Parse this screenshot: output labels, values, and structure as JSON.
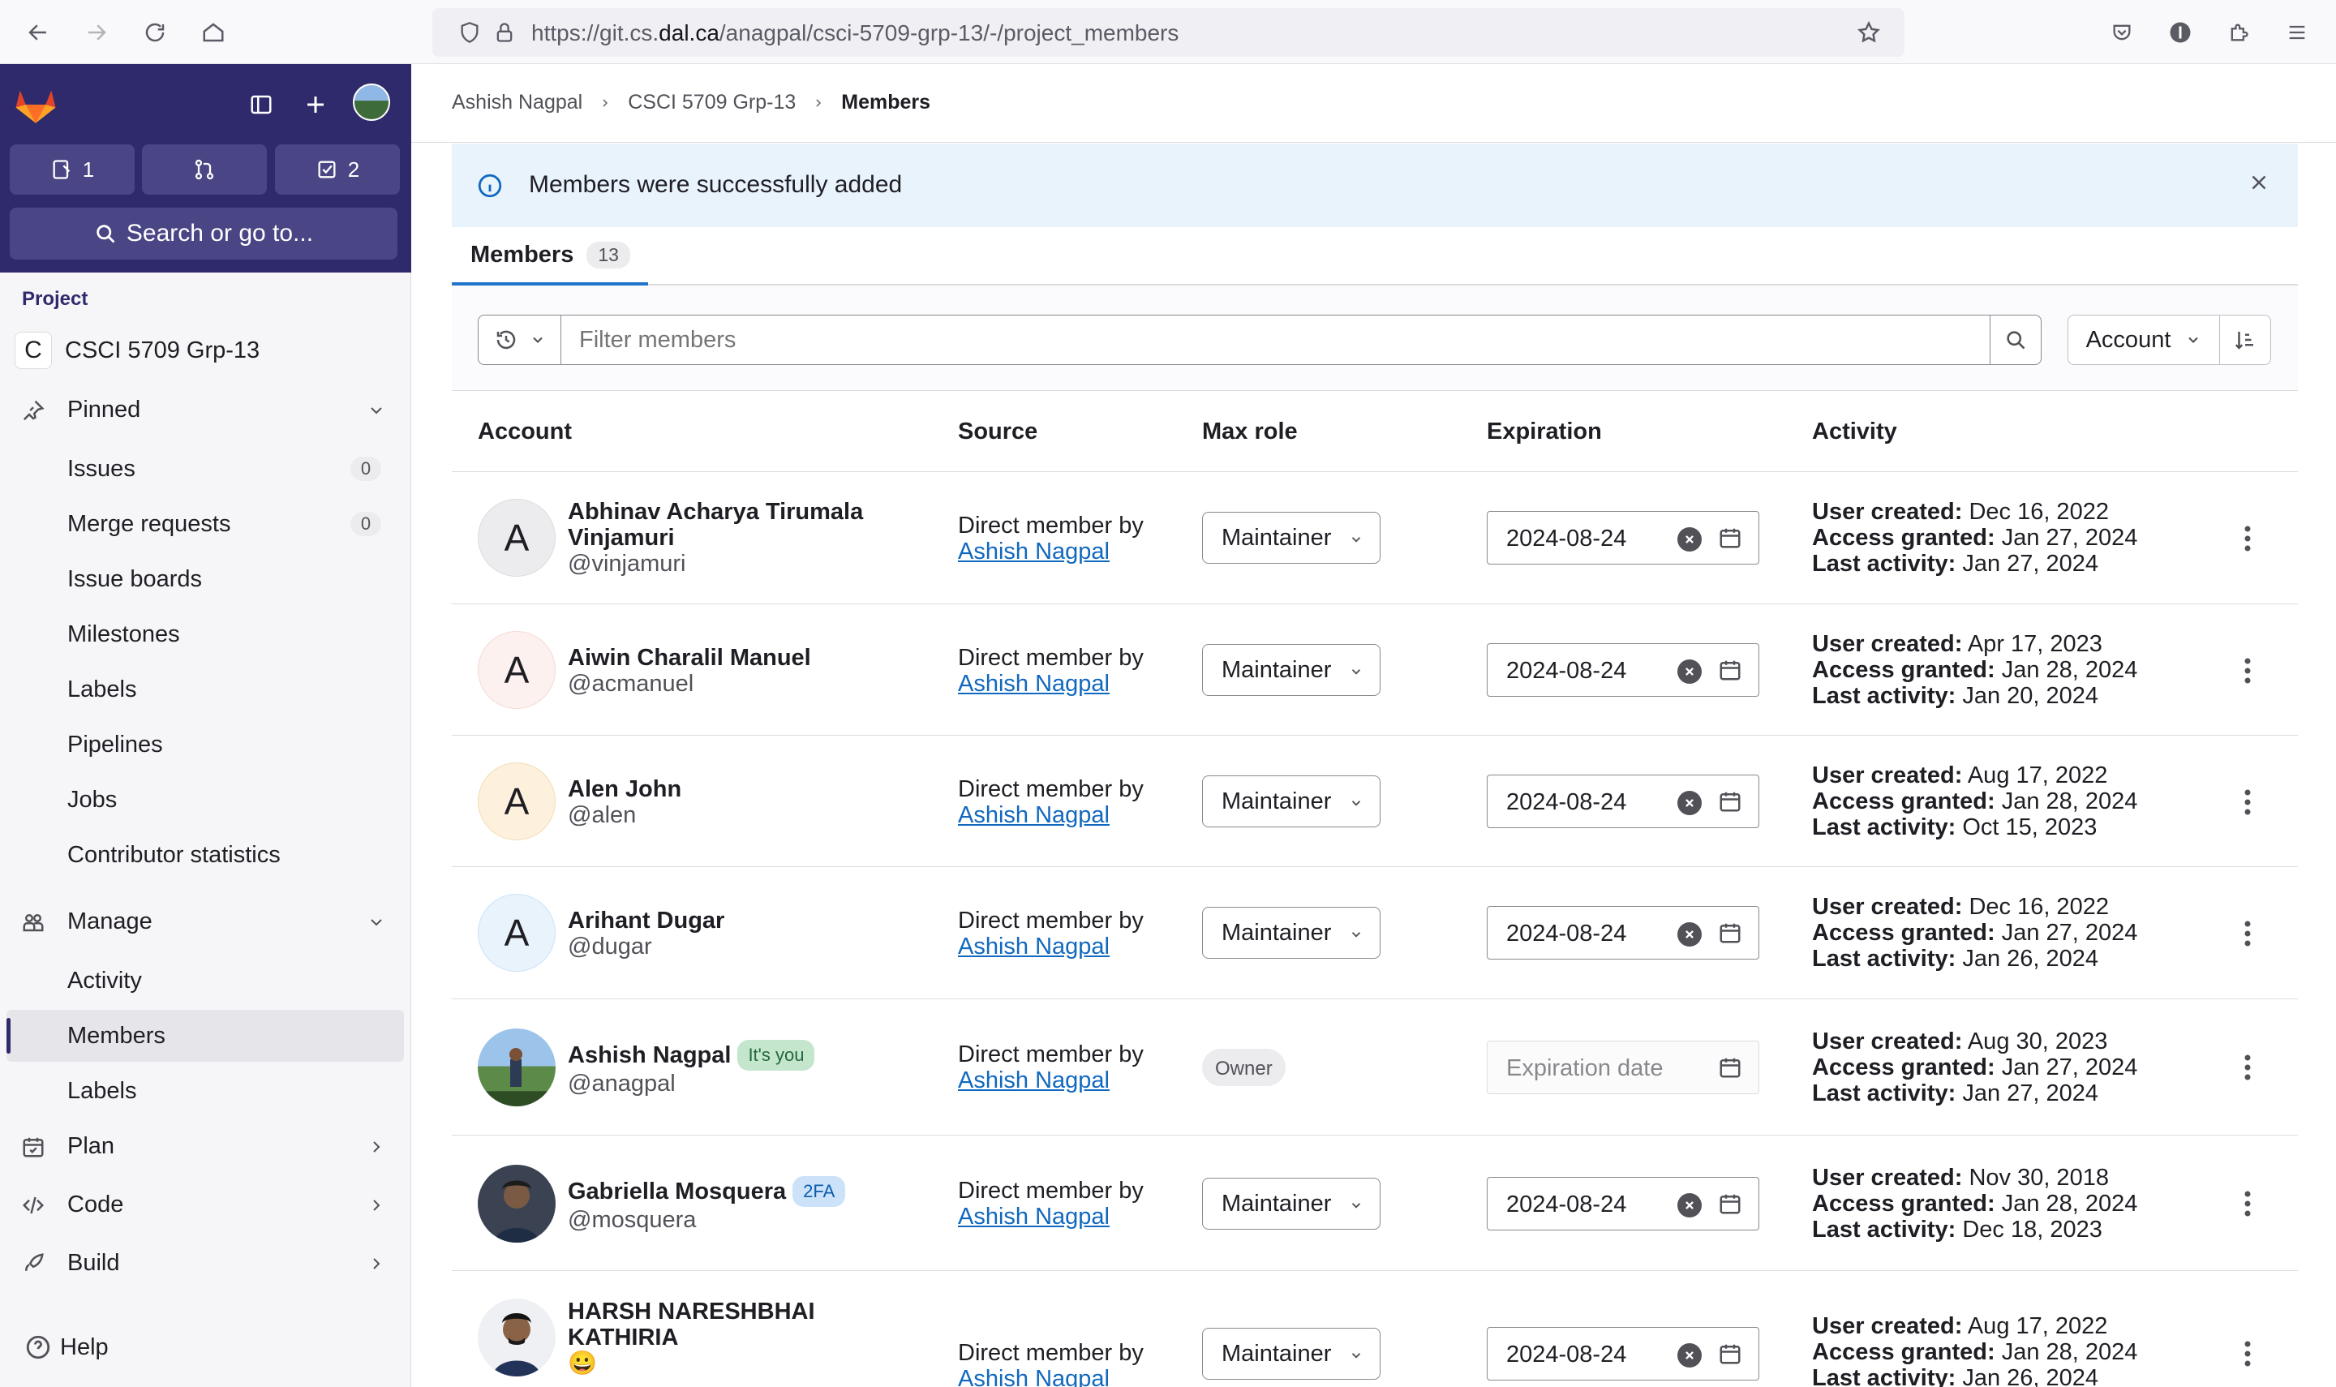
{
  "browser": {
    "url_prefix": "https://git.cs.",
    "url_domain": "dal.ca",
    "url_path": "/anagpal/csci-5709-grp-13/-/project_members"
  },
  "sidebar": {
    "counters": [
      {
        "icon": "issues-icon",
        "count": "1"
      },
      {
        "icon": "merge-request-icon",
        "count": ""
      },
      {
        "icon": "todo-icon",
        "count": "2"
      }
    ],
    "search_label": "Search or go to...",
    "section_label": "Project",
    "project_initial": "C",
    "project_name": "CSCI 5709 Grp-13",
    "pinned_label": "Pinned",
    "pinned_items": [
      {
        "label": "Issues",
        "badge": "0"
      },
      {
        "label": "Merge requests",
        "badge": "0"
      },
      {
        "label": "Issue boards"
      },
      {
        "label": "Milestones"
      },
      {
        "label": "Labels"
      },
      {
        "label": "Pipelines"
      },
      {
        "label": "Jobs"
      },
      {
        "label": "Contributor statistics"
      }
    ],
    "manage_label": "Manage",
    "manage_items": [
      {
        "label": "Activity"
      },
      {
        "label": "Members",
        "active": true
      },
      {
        "label": "Labels"
      }
    ],
    "plan_label": "Plan",
    "code_label": "Code",
    "build_label": "Build",
    "help_label": "Help"
  },
  "breadcrumb": [
    "Ashish Nagpal",
    "CSCI 5709 Grp-13",
    "Members"
  ],
  "alert": {
    "message": "Members were successfully added"
  },
  "tab": {
    "label": "Members",
    "count": "13"
  },
  "filter": {
    "placeholder": "Filter members",
    "sort_label": "Account"
  },
  "table": {
    "headers": [
      "Account",
      "Source",
      "Max role",
      "Expiration",
      "Activity"
    ],
    "activity_labels": {
      "created": "User created:",
      "granted": "Access granted:",
      "last": "Last activity:"
    },
    "source_prefix": "Direct member by",
    "expiration_placeholder": "Expiration date",
    "rows": [
      {
        "initial": "A",
        "name": "Abhinav Acharya Tirumala Vinjamuri",
        "handle": "@vinjamuri",
        "source_user": "Ashish Nagpal",
        "role": "Maintainer",
        "expiration": "2024-08-24",
        "created": "Dec 16, 2022",
        "granted": "Jan 27, 2024",
        "last": "Jan 27, 2024",
        "avatar_color": "#ececef"
      },
      {
        "initial": "A",
        "name": "Aiwin Charalil Manuel",
        "handle": "@acmanuel",
        "source_user": "Ashish Nagpal",
        "role": "Maintainer",
        "expiration": "2024-08-24",
        "created": "Apr 17, 2023",
        "granted": "Jan 28, 2024",
        "last": "Jan 20, 2024",
        "avatar_color": "#fcf1ef"
      },
      {
        "initial": "A",
        "name": "Alen John",
        "handle": "@alen",
        "source_user": "Ashish Nagpal",
        "role": "Maintainer",
        "expiration": "2024-08-24",
        "created": "Aug 17, 2022",
        "granted": "Jan 28, 2024",
        "last": "Oct 15, 2023",
        "avatar_color": "#fdf1dd"
      },
      {
        "initial": "A",
        "name": "Arihant Dugar",
        "handle": "@dugar",
        "source_user": "Ashish Nagpal",
        "role": "Maintainer",
        "expiration": "2024-08-24",
        "created": "Dec 16, 2022",
        "granted": "Jan 27, 2024",
        "last": "Jan 26, 2024",
        "avatar_color": "#e9f3fc"
      },
      {
        "name": "Ashish Nagpal",
        "badge": "It's you",
        "handle": "@anagpal",
        "source_user": "Ashish Nagpal",
        "role": "Owner",
        "expiration": "",
        "created": "Aug 30, 2023",
        "granted": "Jan 27, 2024",
        "last": "Jan 27, 2024"
      },
      {
        "name": "Gabriella Mosquera",
        "badge": "2FA",
        "handle": "@mosquera",
        "source_user": "Ashish Nagpal",
        "role": "Maintainer",
        "expiration": "2024-08-24",
        "created": "Nov 30, 2018",
        "granted": "Jan 28, 2024",
        "last": "Dec 18, 2023"
      },
      {
        "name": "HARSH NARESHBHAI KATHIRIA",
        "handle": "😀",
        "source_user": "Ashish Nagpal",
        "role": "Maintainer",
        "expiration": "2024-08-24",
        "created": "Aug 17, 2022",
        "granted": "Jan 28, 2024",
        "last": "Jan 26, 2024"
      }
    ]
  }
}
